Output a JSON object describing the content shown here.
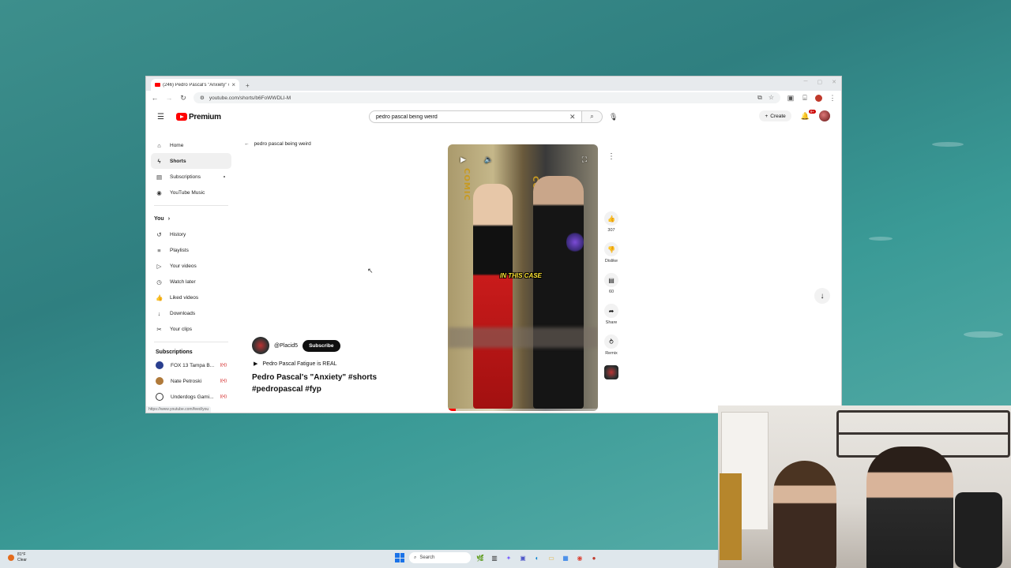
{
  "browser": {
    "tab_title": "(246) Pedro Pascal's \"Anxiety\" #",
    "tab_close": "×",
    "new_tab": "+",
    "url": "youtube.com/shorts/b6FoWWDLI-M",
    "status_url": "https://www.youtube.com/feed/you"
  },
  "header": {
    "logo_text": "Premium",
    "search_value": "pedro pascal being weird",
    "create_label": "Create",
    "notif_count": "9+"
  },
  "sidebar": {
    "items": [
      {
        "label": "Home",
        "icon": "home-icon"
      },
      {
        "label": "Shorts",
        "icon": "shorts-icon"
      },
      {
        "label": "Subscriptions",
        "icon": "subscriptions-icon"
      },
      {
        "label": "YouTube Music",
        "icon": "music-icon"
      }
    ],
    "you_label": "You",
    "you_items": [
      {
        "label": "History",
        "icon": "history-icon"
      },
      {
        "label": "Playlists",
        "icon": "playlists-icon"
      },
      {
        "label": "Your videos",
        "icon": "your-videos-icon"
      },
      {
        "label": "Watch later",
        "icon": "clock-icon"
      },
      {
        "label": "Liked videos",
        "icon": "thumbs-up-icon"
      },
      {
        "label": "Downloads",
        "icon": "download-icon"
      },
      {
        "label": "Your clips",
        "icon": "scissors-icon"
      }
    ],
    "subs_label": "Subscriptions",
    "subscriptions": [
      {
        "label": "FOX 13 Tampa B..."
      },
      {
        "label": "Nate Petroski"
      },
      {
        "label": "Underdogs Gami..."
      }
    ]
  },
  "short": {
    "back_query": "pedro pascal being weird",
    "channel": "@Placid5",
    "subscribe": "Subscribe",
    "playlist": "Pedro Pascal Fatigue is REAL",
    "title": "Pedro Pascal's \"Anxiety\" #shorts #pedropascal #fyp",
    "caption": "IN THIS CASE",
    "progress_fraction": 0.05
  },
  "actions": {
    "like_count": "307",
    "dislike_label": "Dislike",
    "comment_count": "60",
    "share_label": "Share",
    "remix_label": "Remix"
  },
  "taskbar": {
    "temp": "81°F",
    "condition": "Clear",
    "search_label": "Search"
  },
  "colors": {
    "accent_red": "#ff0000",
    "subscribe_bg": "#0f0f0f"
  }
}
